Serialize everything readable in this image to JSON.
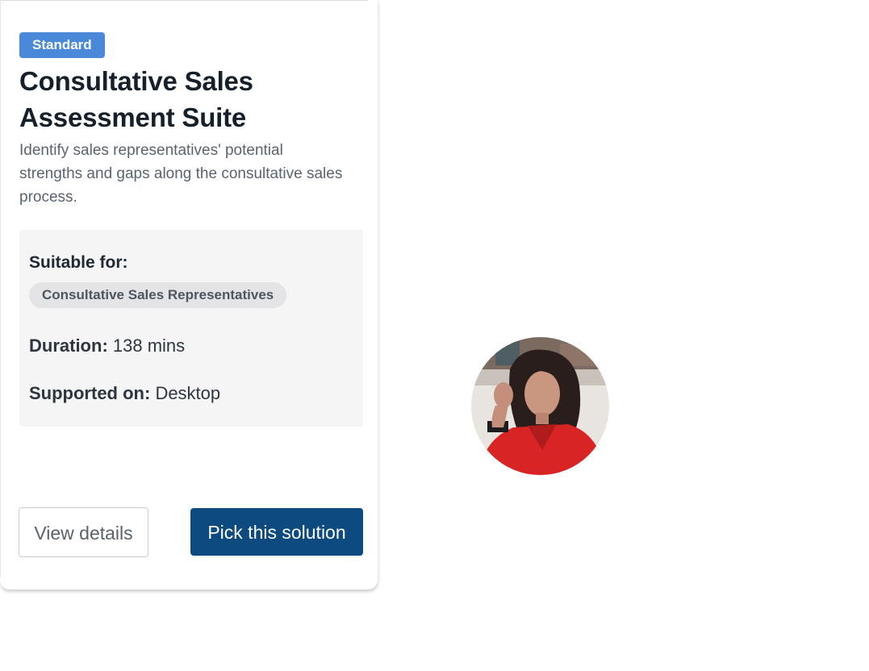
{
  "card": {
    "badge": "Standard",
    "title": "Consultative Sales Assessment Suite",
    "description": "Identify sales representatives' potential strengths and gaps along the consultative sales process.",
    "suitable_for": {
      "heading": "Suitable for:",
      "chips": [
        "Consultative Sales Representatives"
      ]
    },
    "duration": {
      "label": "Duration:",
      "value": "138 mins"
    },
    "supported_on": {
      "label": "Supported on:",
      "value": "Desktop"
    },
    "buttons": {
      "view_details": "View details",
      "pick_solution": "Pick this solution"
    }
  },
  "avatar": {
    "icon": "person-photo-avatar"
  },
  "colors": {
    "badge": "#4a88da",
    "primary_button": "#0c4a80",
    "info_box": "#f5f5f5",
    "chip": "#e4e4e6"
  }
}
